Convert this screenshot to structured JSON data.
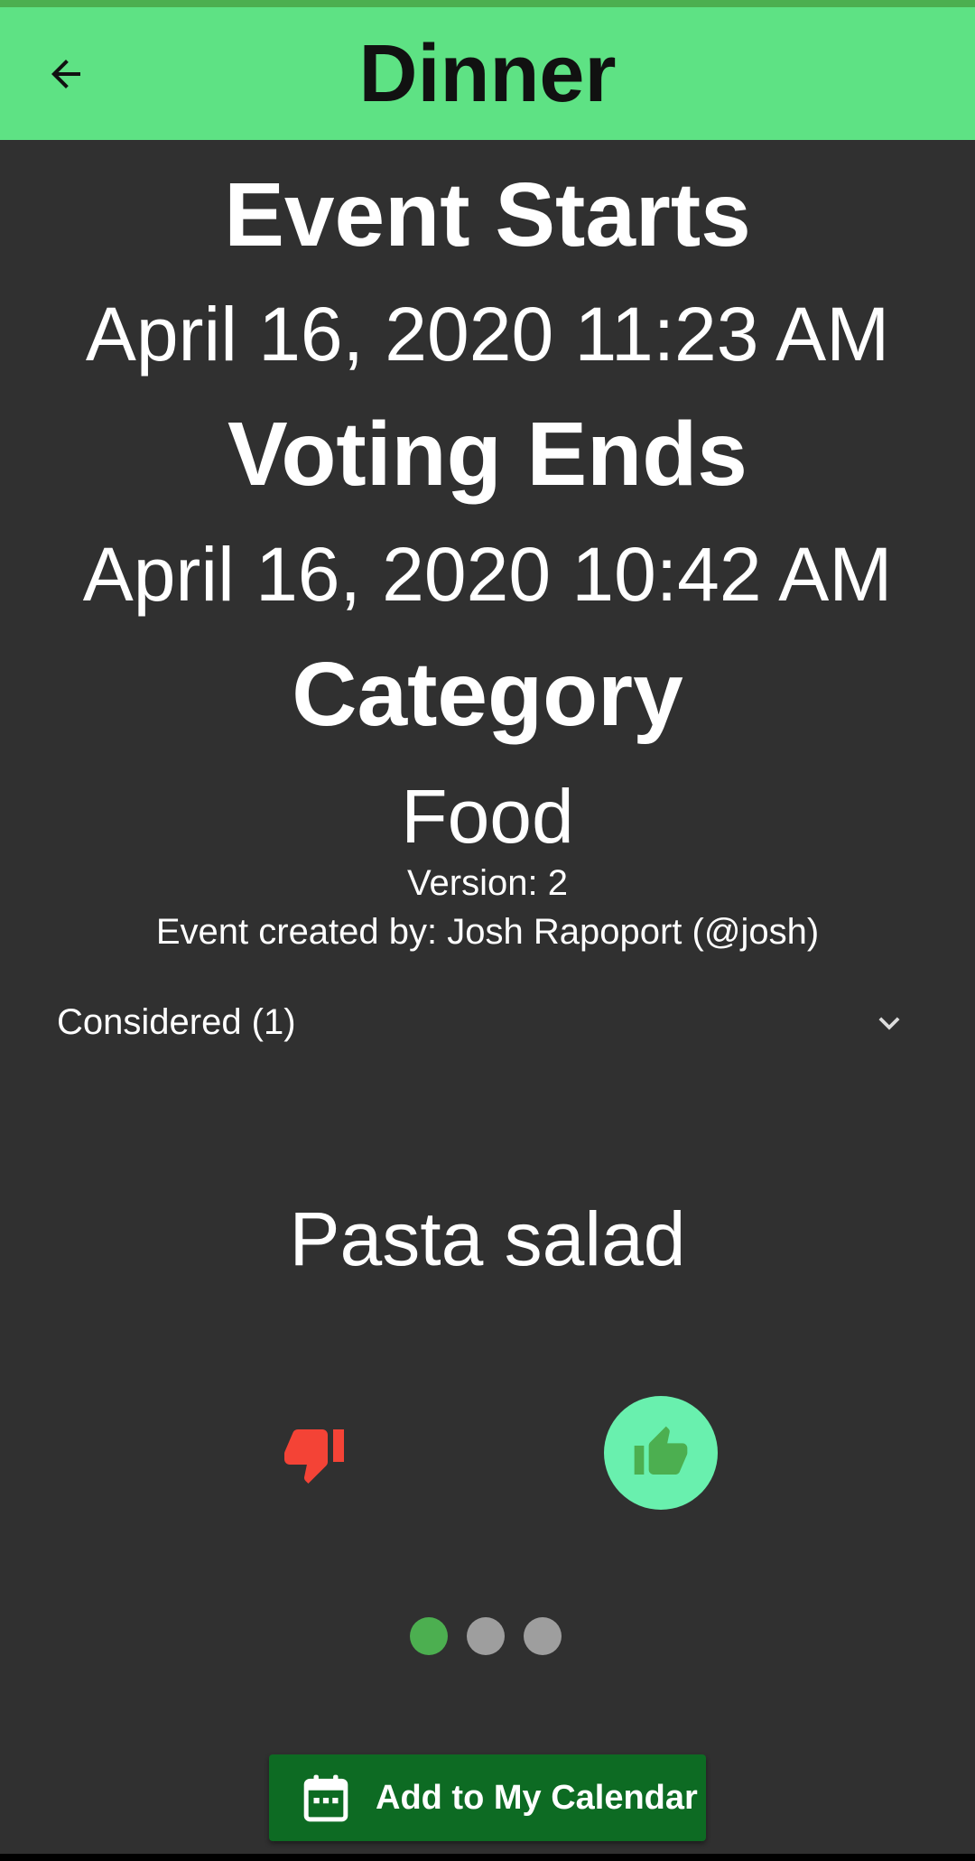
{
  "app_bar": {
    "title": "Dinner"
  },
  "event": {
    "starts_heading": "Event Starts",
    "starts_value": "April 16, 2020 11:23 AM",
    "voting_heading": "Voting Ends",
    "voting_value": "April 16, 2020 10:42 AM",
    "category_heading": "Category",
    "category_value": "Food",
    "version": "Version: 2",
    "created_by": "Event created by: Josh Rapoport (@josh)"
  },
  "considered": {
    "label": "Considered (1)"
  },
  "current_item": {
    "name": "Pasta salad"
  },
  "pager": {
    "count": 3,
    "active_index": 0
  },
  "actions": {
    "calendar_label": "Add to My Calendar"
  },
  "colors": {
    "app_bar": "#5ee284",
    "background": "#303030",
    "thumb_down": "#f44336",
    "thumb_up_circle": "#69f0ae",
    "thumb_up_icon": "#4caf50",
    "calendar_button": "#0d6b23"
  },
  "icons": [
    "arrow-left-icon",
    "chevron-down-icon",
    "thumb-down-icon",
    "thumb-up-icon",
    "calendar-icon"
  ]
}
